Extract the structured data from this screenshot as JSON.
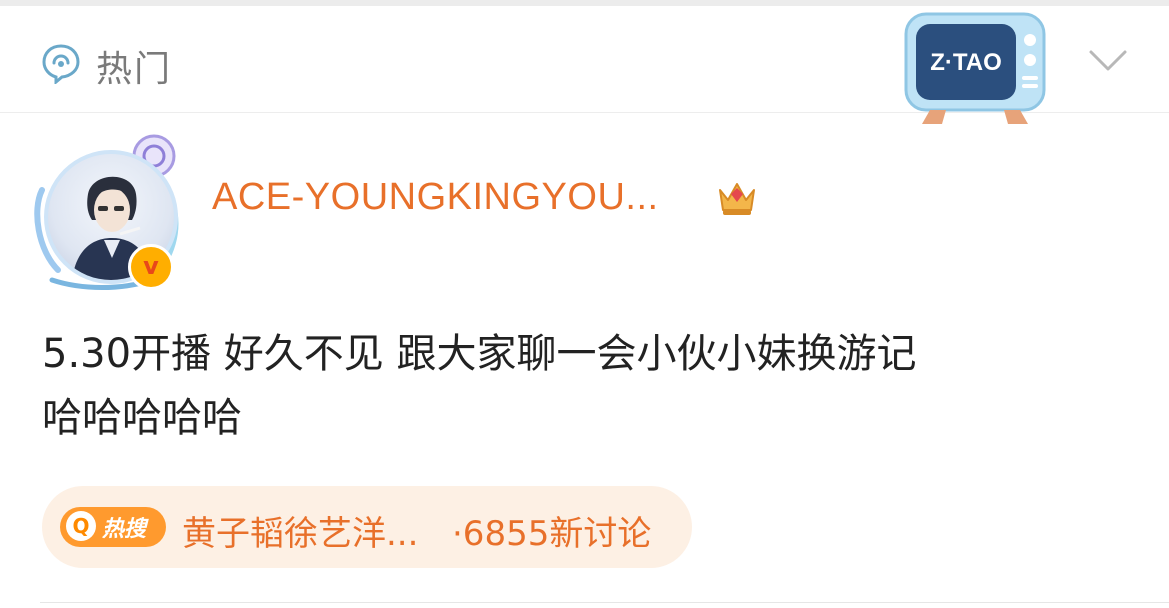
{
  "header": {
    "section_label": "热门",
    "section_icon": "hot-feed-icon",
    "mascot": {
      "logo_text": "Z·TAO",
      "icon": "tv-mascot-icon"
    },
    "menu_icon": "chevron-down-icon"
  },
  "post": {
    "username": "ACE-YOUNGKINGYOU...",
    "verified_icon": "v-verified-icon",
    "badge_icon": "crown-icon",
    "text_line1": "5.30开播 好久不见 跟大家聊一会小伙小妹换游记",
    "text_line2": "哈哈哈哈哈",
    "topic": {
      "tag": "热搜",
      "search_icon": "search-icon",
      "name": "黄子韬徐艺洋...",
      "count": "·6855新讨论"
    }
  },
  "colors": {
    "accent_orange": "#e8702a",
    "tag_orange": "#ff9a2e",
    "pill_bg": "#fdf0e4",
    "text_dark": "#222222",
    "muted_gray": "#7a7a7a"
  }
}
